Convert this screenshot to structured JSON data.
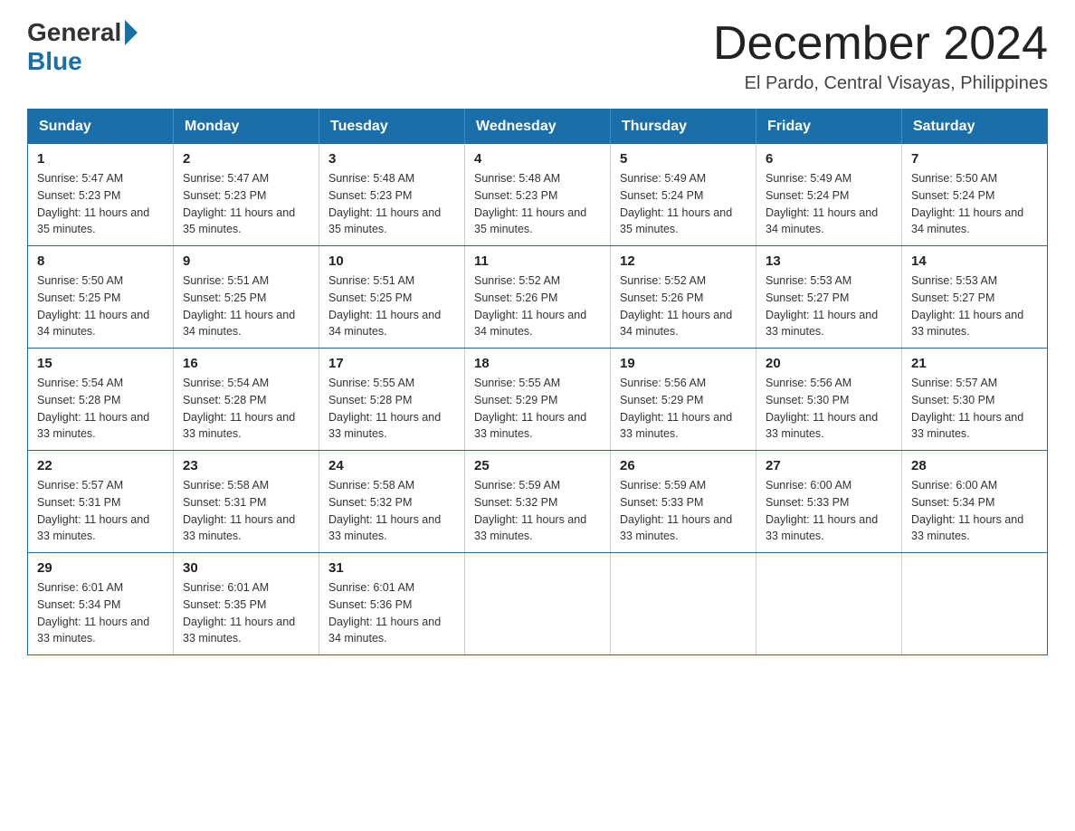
{
  "header": {
    "logo_general": "General",
    "logo_blue": "Blue",
    "month_year": "December 2024",
    "location": "El Pardo, Central Visayas, Philippines"
  },
  "days_of_week": [
    "Sunday",
    "Monday",
    "Tuesday",
    "Wednesday",
    "Thursday",
    "Friday",
    "Saturday"
  ],
  "weeks": [
    [
      {
        "day": "1",
        "sunrise": "5:47 AM",
        "sunset": "5:23 PM",
        "daylight": "11 hours and 35 minutes."
      },
      {
        "day": "2",
        "sunrise": "5:47 AM",
        "sunset": "5:23 PM",
        "daylight": "11 hours and 35 minutes."
      },
      {
        "day": "3",
        "sunrise": "5:48 AM",
        "sunset": "5:23 PM",
        "daylight": "11 hours and 35 minutes."
      },
      {
        "day": "4",
        "sunrise": "5:48 AM",
        "sunset": "5:23 PM",
        "daylight": "11 hours and 35 minutes."
      },
      {
        "day": "5",
        "sunrise": "5:49 AM",
        "sunset": "5:24 PM",
        "daylight": "11 hours and 35 minutes."
      },
      {
        "day": "6",
        "sunrise": "5:49 AM",
        "sunset": "5:24 PM",
        "daylight": "11 hours and 34 minutes."
      },
      {
        "day": "7",
        "sunrise": "5:50 AM",
        "sunset": "5:24 PM",
        "daylight": "11 hours and 34 minutes."
      }
    ],
    [
      {
        "day": "8",
        "sunrise": "5:50 AM",
        "sunset": "5:25 PM",
        "daylight": "11 hours and 34 minutes."
      },
      {
        "day": "9",
        "sunrise": "5:51 AM",
        "sunset": "5:25 PM",
        "daylight": "11 hours and 34 minutes."
      },
      {
        "day": "10",
        "sunrise": "5:51 AM",
        "sunset": "5:25 PM",
        "daylight": "11 hours and 34 minutes."
      },
      {
        "day": "11",
        "sunrise": "5:52 AM",
        "sunset": "5:26 PM",
        "daylight": "11 hours and 34 minutes."
      },
      {
        "day": "12",
        "sunrise": "5:52 AM",
        "sunset": "5:26 PM",
        "daylight": "11 hours and 34 minutes."
      },
      {
        "day": "13",
        "sunrise": "5:53 AM",
        "sunset": "5:27 PM",
        "daylight": "11 hours and 33 minutes."
      },
      {
        "day": "14",
        "sunrise": "5:53 AM",
        "sunset": "5:27 PM",
        "daylight": "11 hours and 33 minutes."
      }
    ],
    [
      {
        "day": "15",
        "sunrise": "5:54 AM",
        "sunset": "5:28 PM",
        "daylight": "11 hours and 33 minutes."
      },
      {
        "day": "16",
        "sunrise": "5:54 AM",
        "sunset": "5:28 PM",
        "daylight": "11 hours and 33 minutes."
      },
      {
        "day": "17",
        "sunrise": "5:55 AM",
        "sunset": "5:28 PM",
        "daylight": "11 hours and 33 minutes."
      },
      {
        "day": "18",
        "sunrise": "5:55 AM",
        "sunset": "5:29 PM",
        "daylight": "11 hours and 33 minutes."
      },
      {
        "day": "19",
        "sunrise": "5:56 AM",
        "sunset": "5:29 PM",
        "daylight": "11 hours and 33 minutes."
      },
      {
        "day": "20",
        "sunrise": "5:56 AM",
        "sunset": "5:30 PM",
        "daylight": "11 hours and 33 minutes."
      },
      {
        "day": "21",
        "sunrise": "5:57 AM",
        "sunset": "5:30 PM",
        "daylight": "11 hours and 33 minutes."
      }
    ],
    [
      {
        "day": "22",
        "sunrise": "5:57 AM",
        "sunset": "5:31 PM",
        "daylight": "11 hours and 33 minutes."
      },
      {
        "day": "23",
        "sunrise": "5:58 AM",
        "sunset": "5:31 PM",
        "daylight": "11 hours and 33 minutes."
      },
      {
        "day": "24",
        "sunrise": "5:58 AM",
        "sunset": "5:32 PM",
        "daylight": "11 hours and 33 minutes."
      },
      {
        "day": "25",
        "sunrise": "5:59 AM",
        "sunset": "5:32 PM",
        "daylight": "11 hours and 33 minutes."
      },
      {
        "day": "26",
        "sunrise": "5:59 AM",
        "sunset": "5:33 PM",
        "daylight": "11 hours and 33 minutes."
      },
      {
        "day": "27",
        "sunrise": "6:00 AM",
        "sunset": "5:33 PM",
        "daylight": "11 hours and 33 minutes."
      },
      {
        "day": "28",
        "sunrise": "6:00 AM",
        "sunset": "5:34 PM",
        "daylight": "11 hours and 33 minutes."
      }
    ],
    [
      {
        "day": "29",
        "sunrise": "6:01 AM",
        "sunset": "5:34 PM",
        "daylight": "11 hours and 33 minutes."
      },
      {
        "day": "30",
        "sunrise": "6:01 AM",
        "sunset": "5:35 PM",
        "daylight": "11 hours and 33 minutes."
      },
      {
        "day": "31",
        "sunrise": "6:01 AM",
        "sunset": "5:36 PM",
        "daylight": "11 hours and 34 minutes."
      },
      null,
      null,
      null,
      null
    ]
  ],
  "labels": {
    "sunrise_prefix": "Sunrise: ",
    "sunset_prefix": "Sunset: ",
    "daylight_prefix": "Daylight: "
  }
}
